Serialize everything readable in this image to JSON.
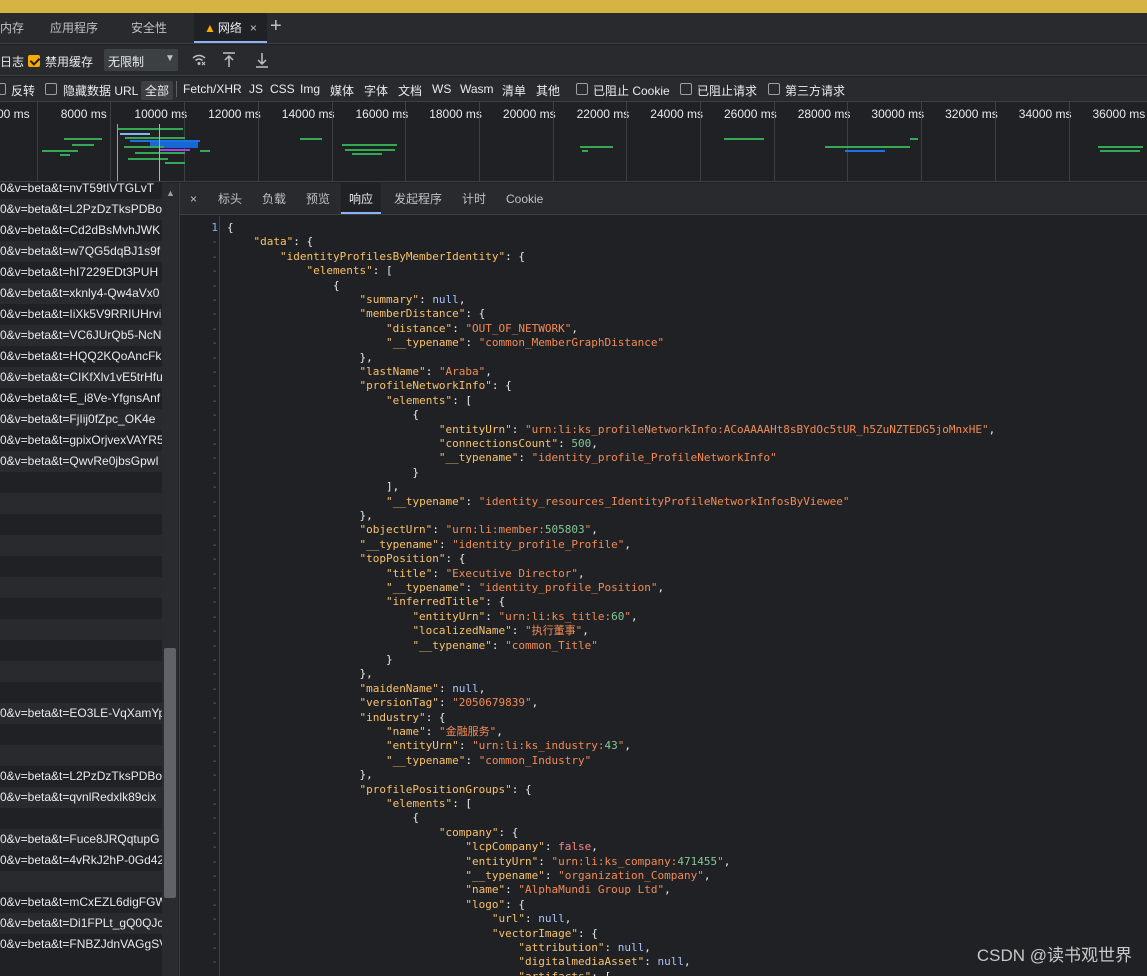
{
  "tabs": [
    {
      "label": "内存",
      "active": false
    },
    {
      "label": "应用程序",
      "active": false
    },
    {
      "label": "安全性",
      "active": false
    },
    {
      "label": "网络",
      "active": true,
      "warning": "▲",
      "close": "×"
    }
  ],
  "tabs_plus": "+",
  "toolbar1": {
    "preserve_log_label": "日志",
    "disable_cache_label": "禁用缓存",
    "disable_cache_checked": true,
    "throttle_value": "无限制",
    "throttle_arrow": "▼",
    "wifi_icon": "wifi-icon",
    "upload_icon": "upload-icon",
    "download_icon": "download-icon"
  },
  "toolbar2": {
    "invert_label": "反转",
    "hide_data_url_label": "隐藏数据 URL",
    "filters": [
      "全部",
      "Fetch/XHR",
      "JS",
      "CSS",
      "Img",
      "媒体",
      "字体",
      "文档",
      "WS",
      "Wasm",
      "清单",
      "其他"
    ],
    "active_filter": "全部",
    "blocked_cookies_label": "已阻止 Cookie",
    "blocked_requests_label": "已阻止请求",
    "third_party_label": "第三方请求"
  },
  "timeline": {
    "ticks": [
      "00 ms",
      "8000 ms",
      "10000 ms",
      "12000 ms",
      "14000 ms",
      "16000 ms",
      "18000 ms",
      "20000 ms",
      "22000 ms",
      "24000 ms",
      "26000 ms",
      "28000 ms",
      "30000 ms",
      "32000 ms",
      "34000 ms",
      "36000 ms"
    ]
  },
  "request_list": [
    "0&v=beta&t=nvT59tIVTGLvT",
    "0&v=beta&t=L2PzDzTksPDBo",
    "0&v=beta&t=Cd2dBsMvhJWK",
    "0&v=beta&t=w7QG5dqBJ1s9f",
    "0&v=beta&t=hI7229EDt3PUH",
    "0&v=beta&t=xknly4-Qw4aVx0",
    "0&v=beta&t=IiXk5V9RRIUHrvi",
    "0&v=beta&t=VC6JUrQb5-NcN",
    "0&v=beta&t=HQQ2KQoAncFk",
    "0&v=beta&t=CIKfXlv1vE5trHfu",
    "0&v=beta&t=E_i8Ve-YfgnsAnf",
    "0&v=beta&t=FjIij0fZpc_OK4e",
    "0&v=beta&t=gpixOrjvexVAYR5",
    "0&v=beta&t=QwvRe0jbsGpwI",
    "",
    "",
    "",
    "",
    "",
    "",
    "",
    "",
    "",
    "",
    "",
    "0&v=beta&t=EO3LE-VqXamYp",
    "",
    "",
    "0&v=beta&t=L2PzDzTksPDBo",
    "0&v=beta&t=qvnlRedxlk89cix",
    "",
    "0&v=beta&t=Fuce8JRQqtupG",
    "0&v=beta&t=4vRkJ2hP-0Gd42",
    "",
    "0&v=beta&t=mCxEZL6digFGW",
    "0&v=beta&t=Di1FPLt_gQ0QJc",
    "0&v=beta&t=FNBZJdnVAGgSV"
  ],
  "detail_tabs": [
    {
      "label": "标头",
      "active": false
    },
    {
      "label": "负载",
      "active": false
    },
    {
      "label": "预览",
      "active": false
    },
    {
      "label": "响应",
      "active": true
    },
    {
      "label": "发起程序",
      "active": false
    },
    {
      "label": "计时",
      "active": false
    },
    {
      "label": "Cookie",
      "active": false
    }
  ],
  "detail_close": "×",
  "response_lines": [
    {
      "ln": "1",
      "text": "{"
    },
    {
      "ln": "-",
      "text": "    \"data\": {"
    },
    {
      "ln": "-",
      "text": "        \"identityProfilesByMemberIdentity\": {"
    },
    {
      "ln": "-",
      "text": "            \"elements\": ["
    },
    {
      "ln": "-",
      "text": "                {"
    },
    {
      "ln": "-",
      "text": "                    \"summary\": null,"
    },
    {
      "ln": "-",
      "text": "                    \"memberDistance\": {"
    },
    {
      "ln": "-",
      "text": "                        \"distance\": \"OUT_OF_NETWORK\","
    },
    {
      "ln": "-",
      "text": "                        \"__typename\": \"common_MemberGraphDistance\""
    },
    {
      "ln": "-",
      "text": "                    },"
    },
    {
      "ln": "-",
      "text": "                    \"lastName\": \"Araba\","
    },
    {
      "ln": "-",
      "text": "                    \"profileNetworkInfo\": {"
    },
    {
      "ln": "-",
      "text": "                        \"elements\": ["
    },
    {
      "ln": "-",
      "text": "                            {"
    },
    {
      "ln": "-",
      "text": "                                \"entityUrn\": \"urn:li:ks_profileNetworkInfo:ACoAAAAHt8sBYdOc5tUR_h5ZuNZTEDG5joMnxHE\","
    },
    {
      "ln": "-",
      "text": "                                \"connectionsCount\": 500,"
    },
    {
      "ln": "-",
      "text": "                                \"__typename\": \"identity_profile_ProfileNetworkInfo\""
    },
    {
      "ln": "-",
      "text": "                            }"
    },
    {
      "ln": "-",
      "text": "                        ],"
    },
    {
      "ln": "-",
      "text": "                        \"__typename\": \"identity_resources_IdentityProfileNetworkInfosByViewee\""
    },
    {
      "ln": "-",
      "text": "                    },"
    },
    {
      "ln": "-",
      "text": "                    \"objectUrn\": \"urn:li:member:505803\","
    },
    {
      "ln": "-",
      "text": "                    \"__typename\": \"identity_profile_Profile\","
    },
    {
      "ln": "-",
      "text": "                    \"topPosition\": {"
    },
    {
      "ln": "-",
      "text": "                        \"title\": \"Executive Director\","
    },
    {
      "ln": "-",
      "text": "                        \"__typename\": \"identity_profile_Position\","
    },
    {
      "ln": "-",
      "text": "                        \"inferredTitle\": {"
    },
    {
      "ln": "-",
      "text": "                            \"entityUrn\": \"urn:li:ks_title:60\","
    },
    {
      "ln": "-",
      "text": "                            \"localizedName\": \"执行董事\","
    },
    {
      "ln": "-",
      "text": "                            \"__typename\": \"common_Title\""
    },
    {
      "ln": "-",
      "text": "                        }"
    },
    {
      "ln": "-",
      "text": "                    },"
    },
    {
      "ln": "-",
      "text": "                    \"maidenName\": null,"
    },
    {
      "ln": "-",
      "text": "                    \"versionTag\": \"2050679839\","
    },
    {
      "ln": "-",
      "text": "                    \"industry\": {"
    },
    {
      "ln": "-",
      "text": "                        \"name\": \"金融服务\","
    },
    {
      "ln": "-",
      "text": "                        \"entityUrn\": \"urn:li:ks_industry:43\","
    },
    {
      "ln": "-",
      "text": "                        \"__typename\": \"common_Industry\""
    },
    {
      "ln": "-",
      "text": "                    },"
    },
    {
      "ln": "-",
      "text": "                    \"profilePositionGroups\": {"
    },
    {
      "ln": "-",
      "text": "                        \"elements\": ["
    },
    {
      "ln": "-",
      "text": "                            {"
    },
    {
      "ln": "-",
      "text": "                                \"company\": {"
    },
    {
      "ln": "-",
      "text": "                                    \"lcpCompany\": false,"
    },
    {
      "ln": "-",
      "text": "                                    \"entityUrn\": \"urn:li:ks_company:471455\","
    },
    {
      "ln": "-",
      "text": "                                    \"__typename\": \"organization_Company\","
    },
    {
      "ln": "-",
      "text": "                                    \"name\": \"AlphaMundi Group Ltd\","
    },
    {
      "ln": "-",
      "text": "                                    \"logo\": {"
    },
    {
      "ln": "-",
      "text": "                                        \"url\": null,"
    },
    {
      "ln": "-",
      "text": "                                        \"vectorImage\": {"
    },
    {
      "ln": "-",
      "text": "                                            \"attribution\": null,"
    },
    {
      "ln": "-",
      "text": "                                            \"digitalmediaAsset\": null,"
    },
    {
      "ln": "-",
      "text": "                                            \"artifacts\": ["
    }
  ],
  "watermark": "CSDN @读书观世界",
  "colors": {
    "accent": "#8ab4f8",
    "warning": "#f9ab00",
    "json_key": "#f9c26b",
    "json_string": "#f28b54",
    "json_null": "#a8c7fa",
    "json_bool": "#f28b82",
    "json_number": "#81c995"
  }
}
